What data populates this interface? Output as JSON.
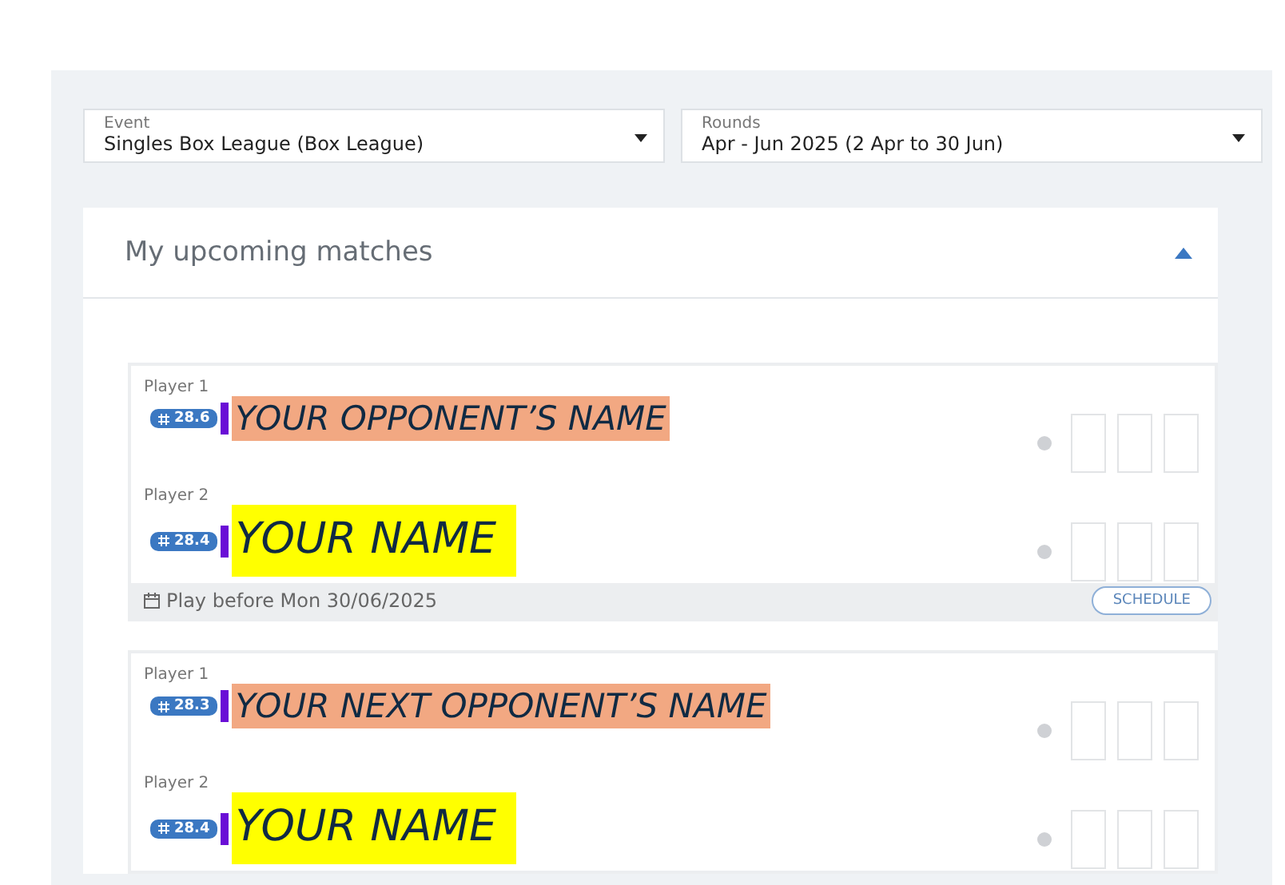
{
  "filters": [
    {
      "label": "Event",
      "value": "Singles Box League (Box League)"
    },
    {
      "label": "Rounds",
      "value": "Apr - Jun 2025 (2 Apr to 30 Jun)"
    }
  ],
  "section": {
    "title": "My upcoming matches",
    "expanded": true
  },
  "matches": [
    {
      "players": [
        {
          "label": "Player 1",
          "rating": "28.6",
          "name": "YOUR OPPONENT’S NAME",
          "color": "#f2a882",
          "kind": "opponent"
        },
        {
          "label": "Player 2",
          "rating": "28.4",
          "name": "YOUR NAME",
          "color": "#ffff00",
          "kind": "self"
        }
      ],
      "footer": {
        "deadline": "Play before Mon 30/06/2025",
        "button": "SCHEDULE"
      }
    },
    {
      "players": [
        {
          "label": "Player 1",
          "rating": "28.3",
          "name": "YOUR NEXT OPPONENT’S NAME",
          "color": "#f2a882",
          "kind": "opponent"
        },
        {
          "label": "Player 2",
          "rating": "28.4",
          "name": "YOUR NAME",
          "color": "#ffff00",
          "kind": "self"
        }
      ]
    }
  ]
}
